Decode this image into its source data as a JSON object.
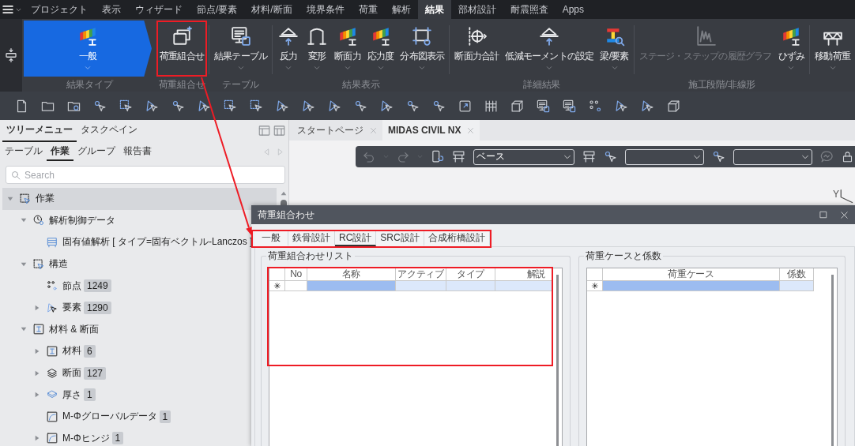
{
  "menu_bar": {
    "tabs": [
      {
        "label": "プロジェクト",
        "selected": false
      },
      {
        "label": "表示",
        "selected": false
      },
      {
        "label": "ウィザード",
        "selected": false
      },
      {
        "label": "節点/要素",
        "selected": false
      },
      {
        "label": "材料/断面",
        "selected": false
      },
      {
        "label": "境界条件",
        "selected": false
      },
      {
        "label": "荷重",
        "selected": false
      },
      {
        "label": "解析",
        "selected": false
      },
      {
        "label": "結果",
        "selected": true
      },
      {
        "label": "部材設計",
        "selected": false
      },
      {
        "label": "耐震照査",
        "selected": false
      },
      {
        "label": "Apps",
        "selected": false
      }
    ]
  },
  "ribbon": {
    "groups": [
      {
        "kind": "selector",
        "label": "結果タイプ",
        "buttons": [
          {
            "label": "一般",
            "dropdown": true,
            "disabled": false,
            "highlighted": false
          }
        ]
      },
      {
        "kind": "buttons",
        "label": "荷重組合せ",
        "buttons": [
          {
            "label": "荷重組合せ",
            "dropdown": false,
            "disabled": false,
            "highlighted": true
          }
        ]
      },
      {
        "kind": "buttons",
        "label": "テーブル",
        "buttons": [
          {
            "label": "結果テーブル",
            "dropdown": true,
            "disabled": false,
            "highlighted": false
          }
        ]
      },
      {
        "kind": "buttons",
        "label": "結果表示",
        "buttons": [
          {
            "label": "反力",
            "dropdown": true,
            "disabled": false,
            "highlighted": false
          },
          {
            "label": "変形",
            "dropdown": true,
            "disabled": false,
            "highlighted": false
          },
          {
            "label": "断面力",
            "dropdown": true,
            "disabled": false,
            "highlighted": false
          },
          {
            "label": "応力度",
            "dropdown": true,
            "disabled": false,
            "highlighted": false
          },
          {
            "label": "分布図表示",
            "dropdown": true,
            "disabled": false,
            "highlighted": false
          }
        ]
      },
      {
        "kind": "buttons",
        "label": "詳細結果",
        "buttons": [
          {
            "label": "断面力合計",
            "dropdown": false,
            "disabled": false,
            "highlighted": false
          },
          {
            "label": "低減モーメントの設定",
            "dropdown": true,
            "disabled": false,
            "highlighted": false
          },
          {
            "label": "梁/要素",
            "dropdown": true,
            "disabled": false,
            "highlighted": false
          }
        ]
      },
      {
        "kind": "buttons",
        "label": "施工段階/非線形",
        "buttons": [
          {
            "label": "ステージ・ステップの履歴グラフ",
            "dropdown": false,
            "disabled": true,
            "highlighted": false
          },
          {
            "label": "ひずみ",
            "dropdown": true,
            "disabled": false,
            "highlighted": false
          }
        ]
      },
      {
        "kind": "buttons",
        "buttons": [
          {
            "label": "移動荷重",
            "dropdown": true,
            "disabled": false,
            "highlighted": false
          }
        ]
      }
    ]
  },
  "left_panel": {
    "tabs": [
      {
        "label": "ツリーメニュー",
        "selected": true
      },
      {
        "label": "タスクペイン",
        "selected": false
      }
    ],
    "subtabs": [
      {
        "label": "テーブル",
        "selected": false
      },
      {
        "label": "作業",
        "selected": true
      },
      {
        "label": "グループ",
        "selected": false
      },
      {
        "label": "報告書",
        "selected": false
      }
    ],
    "search": {
      "placeholder": "Search"
    },
    "tree": [
      {
        "label": "作業",
        "expanded": true,
        "selected": true,
        "children": [
          {
            "label": "解析制御データ",
            "expanded": true,
            "selected": false,
            "children": [
              {
                "label": "固有値解析 [ タイプ=固有ベクトル-Lanczos ]",
                "selected": false
              }
            ]
          },
          {
            "label": "構造",
            "expanded": true,
            "selected": false,
            "children": [
              {
                "label": "節点",
                "count": "1249",
                "selected": false
              },
              {
                "label": "要素",
                "count": "1290",
                "expanded": false,
                "selected": false
              }
            ]
          },
          {
            "label": "材料 & 断面",
            "expanded": true,
            "selected": false,
            "children": [
              {
                "label": "材料",
                "count": "6",
                "expanded": false,
                "selected": false
              },
              {
                "label": "断面",
                "count": "127",
                "expanded": false,
                "selected": false
              },
              {
                "label": "厚さ",
                "count": "1",
                "expanded": false,
                "selected": false
              },
              {
                "label": "M-Φグローバルデータ",
                "count": "1",
                "selected": false
              },
              {
                "label": "M-Φヒンジ",
                "count": "1",
                "expanded": false,
                "selected": false
              }
            ]
          }
        ]
      }
    ]
  },
  "document_tabs": [
    {
      "label": "スタートページ",
      "selected": false
    },
    {
      "label": "MIDAS CIVIL NX",
      "selected": true
    }
  ],
  "view_toolbar": {
    "undo_disabled": true,
    "redo_disabled": true,
    "view_select": "ベース"
  },
  "axis_label": "Y",
  "dialog": {
    "title": "荷重組合わせ",
    "tabs": [
      {
        "label": "一般",
        "selected": false
      },
      {
        "label": "鉄骨設計",
        "selected": false
      },
      {
        "label": "RC設計",
        "selected": true
      },
      {
        "label": "SRC設計",
        "selected": false
      },
      {
        "label": "合成桁橋設計",
        "selected": false
      }
    ],
    "tabs_highlighted": true,
    "groups": [
      {
        "title": "荷重組合わせリスト",
        "highlighted": true,
        "new_row_marker": "✳",
        "columns": [
          {
            "label": "No",
            "kind": "index"
          },
          {
            "label": "名称",
            "kind": "key"
          },
          {
            "label": "アクティブ",
            "kind": "field"
          },
          {
            "label": "タイプ",
            "kind": "field"
          },
          {
            "label": "解説",
            "kind": "field"
          }
        ]
      },
      {
        "title": "荷重ケースと係数",
        "highlighted": false,
        "new_row_marker": "✳",
        "columns": [
          {
            "label": "荷重ケース",
            "kind": "key"
          },
          {
            "label": "係数",
            "kind": "field"
          }
        ]
      }
    ]
  },
  "callout_arrow": true
}
